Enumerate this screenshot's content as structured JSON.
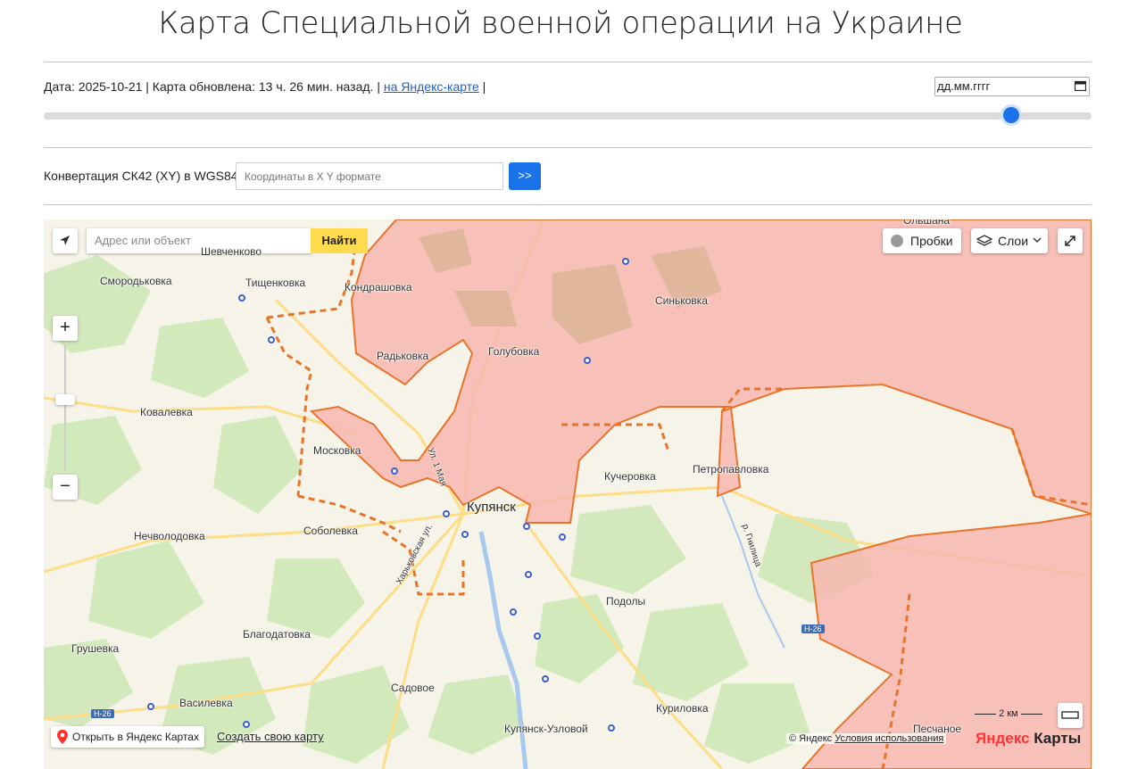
{
  "page": {
    "title": "Карта Специальной военной операции на Украине",
    "date_text": "Дата: 2025-10-21 | Карта обновлена: 13 ч. 26 мин. назад. |",
    "yandex_link": "на Яндекс-карте",
    "sep": "|",
    "date_placeholder": "дд.мм.гггг",
    "slider_value_fraction": 0.92,
    "convert_label": "Конвертация СК42 (XY) в WGS84:",
    "coord_placeholder": "Координаты в X Y формате",
    "convert_button": ">>"
  },
  "map": {
    "search_placeholder": "Адрес или объект",
    "find_button": "Найти",
    "traffic_button": "Пробки",
    "layers_button": "Слои",
    "zoom_in": "+",
    "zoom_out": "−",
    "open_in_yandex": "Открыть в Яндекс Картах",
    "create_map": "Создать свою карту",
    "copyright": "© Яндекс",
    "terms": "Условия использования",
    "logo_black": "Яндекс",
    "logo_red": "Карты",
    "scale": "2 км",
    "colors": {
      "occupied_fill": "#f7b7b0",
      "border_line": "#e8742a",
      "button_blue": "#1a73e8",
      "find_yellow": "#ffdb4d"
    },
    "places": {
      "olshana": "Ольшана",
      "shevchenkovo": "Шевченково",
      "smorodkovka": "Смородьковка",
      "tishchenkovka": "Тищенковка",
      "kondrashovka": "Кондрашовка",
      "sinkovka": "Синьковка",
      "golubovka": "Голубовка",
      "radkovka": "Радьковка",
      "kovalevka": "Ковалевка",
      "moskovka": "Московка",
      "kupyansk": "Купянск",
      "kucherovka": "Кучеровка",
      "petropavlovka": "Петропавловка",
      "sobolevka": "Соболевка",
      "nechvolodovka": "Нечволодовка",
      "podoly": "Подолы",
      "blagodatovka": "Благодатовка",
      "grushevka": "Грушевка",
      "sadovoe": "Садовое",
      "vasilevka": "Василевка",
      "kurilovka": "Куриловка",
      "kupyansk_uzlovoy": "Купянск-Узловой",
      "peschanoe": "Песчаное",
      "street_1": "Ул. 1 Мая",
      "street_2": "Харьковская ул.",
      "river": "р. Гнилица",
      "road_1": "Н-26",
      "road_2": "Н-26"
    }
  }
}
